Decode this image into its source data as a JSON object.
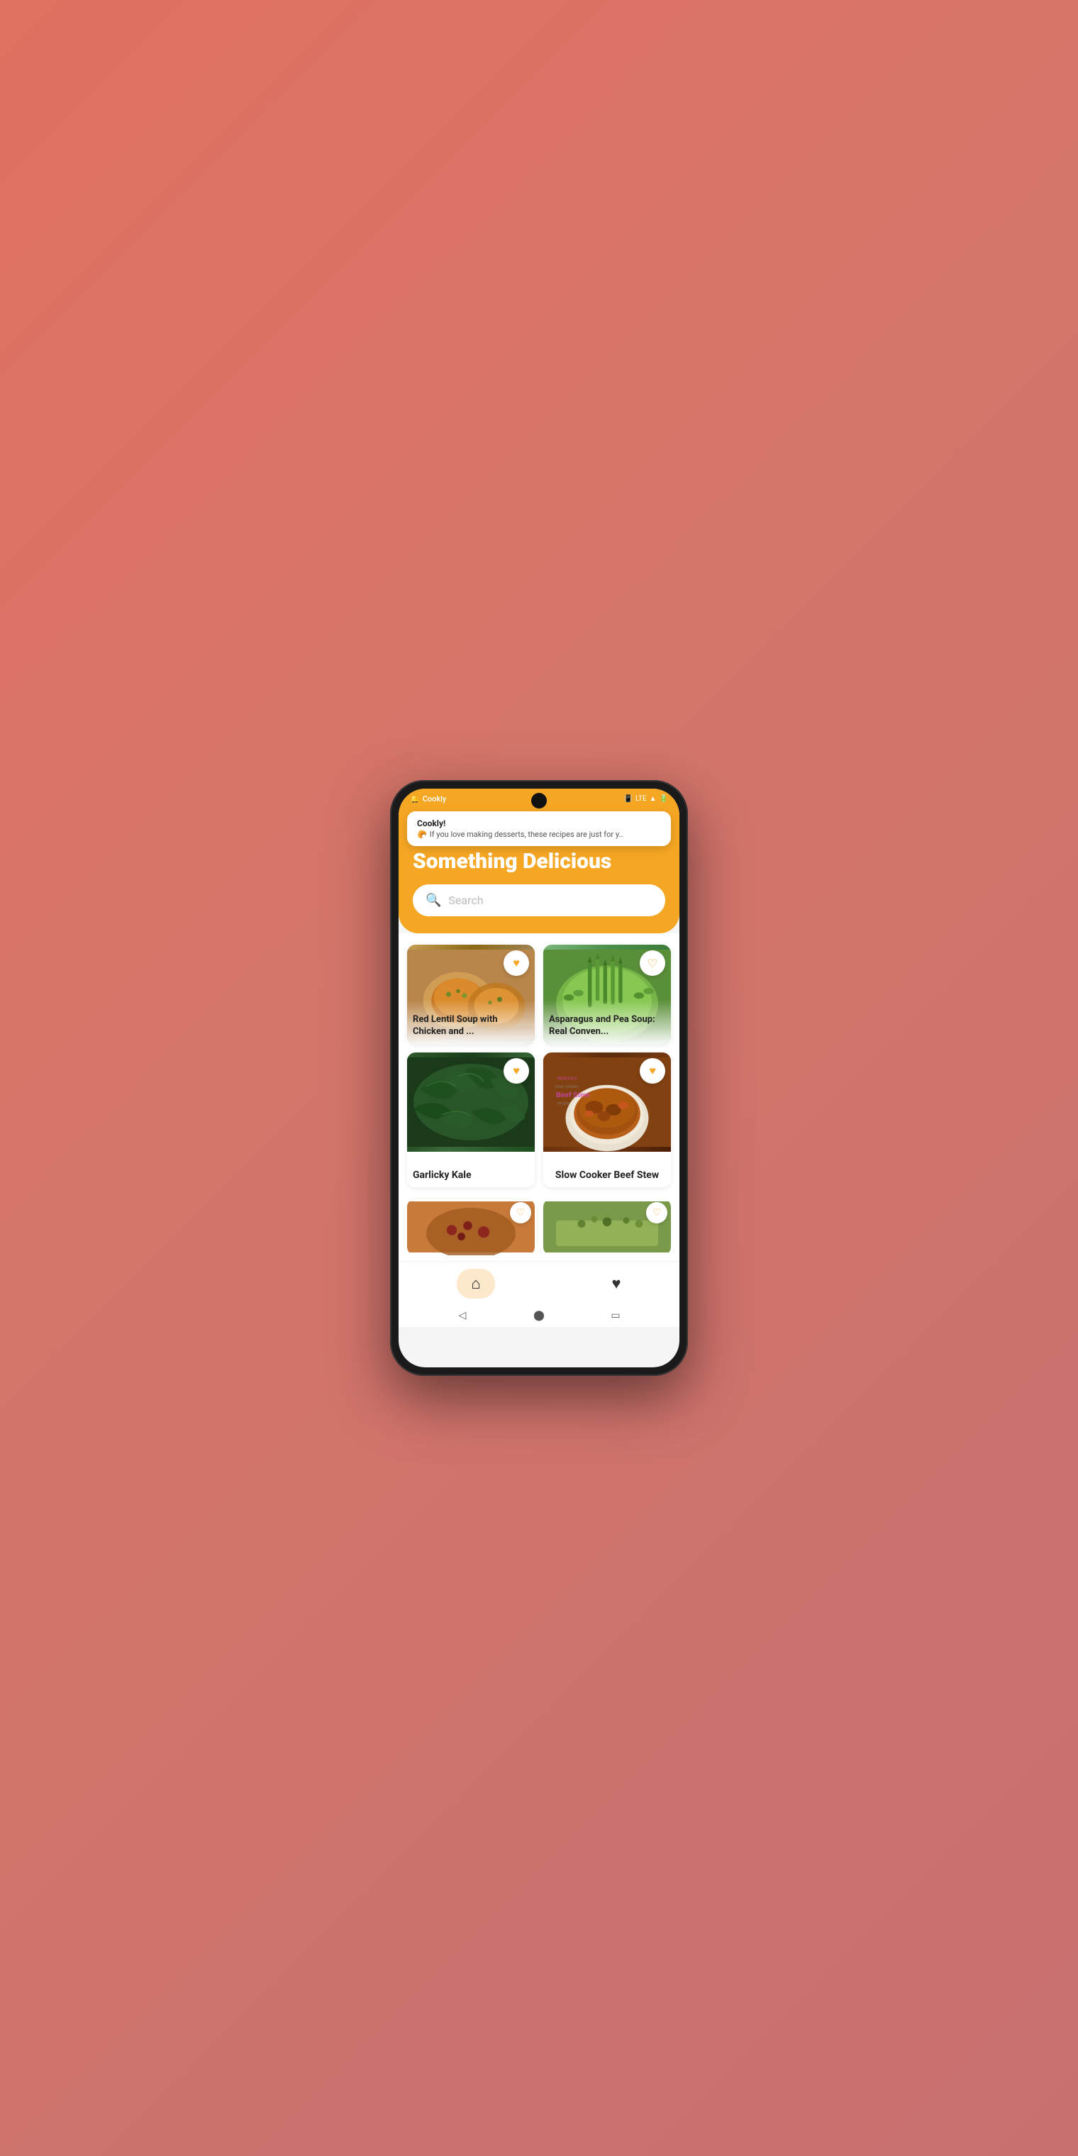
{
  "app": {
    "name": "Cookly",
    "status_vibrate": "📳",
    "status_lte": "LTE",
    "status_signal": "▲",
    "status_battery": "🔋"
  },
  "notification": {
    "title": "Cookly!",
    "emoji": "🥐",
    "body": "If you love making desserts, these recipes are just for y.."
  },
  "header": {
    "title": "Something Delicious"
  },
  "search": {
    "placeholder": "Search"
  },
  "recipes": [
    {
      "id": 1,
      "title": "Red Lentil Soup with Chicken and ...",
      "image_class": "img-red-lentil",
      "heart_filled": true
    },
    {
      "id": 2,
      "title": "Asparagus and Pea Soup: Real Conven...",
      "image_class": "img-asparagus",
      "heart_filled": false
    },
    {
      "id": 3,
      "title": "Garlicky Kale",
      "image_class": "img-kale",
      "heart_filled": true
    },
    {
      "id": 4,
      "title": "Slow Cooker Beef Stew",
      "image_class": "img-beef-stew",
      "heart_filled": true
    },
    {
      "id": 5,
      "title": "",
      "image_class": "img-beans",
      "heart_filled": false
    },
    {
      "id": 6,
      "title": "",
      "image_class": "img-quinoa",
      "heart_filled": false
    }
  ],
  "bottom_nav": {
    "home_label": "home",
    "favorites_label": "favorites"
  },
  "colors": {
    "orange": "#f5a623",
    "white": "#ffffff",
    "dark": "#222222"
  }
}
